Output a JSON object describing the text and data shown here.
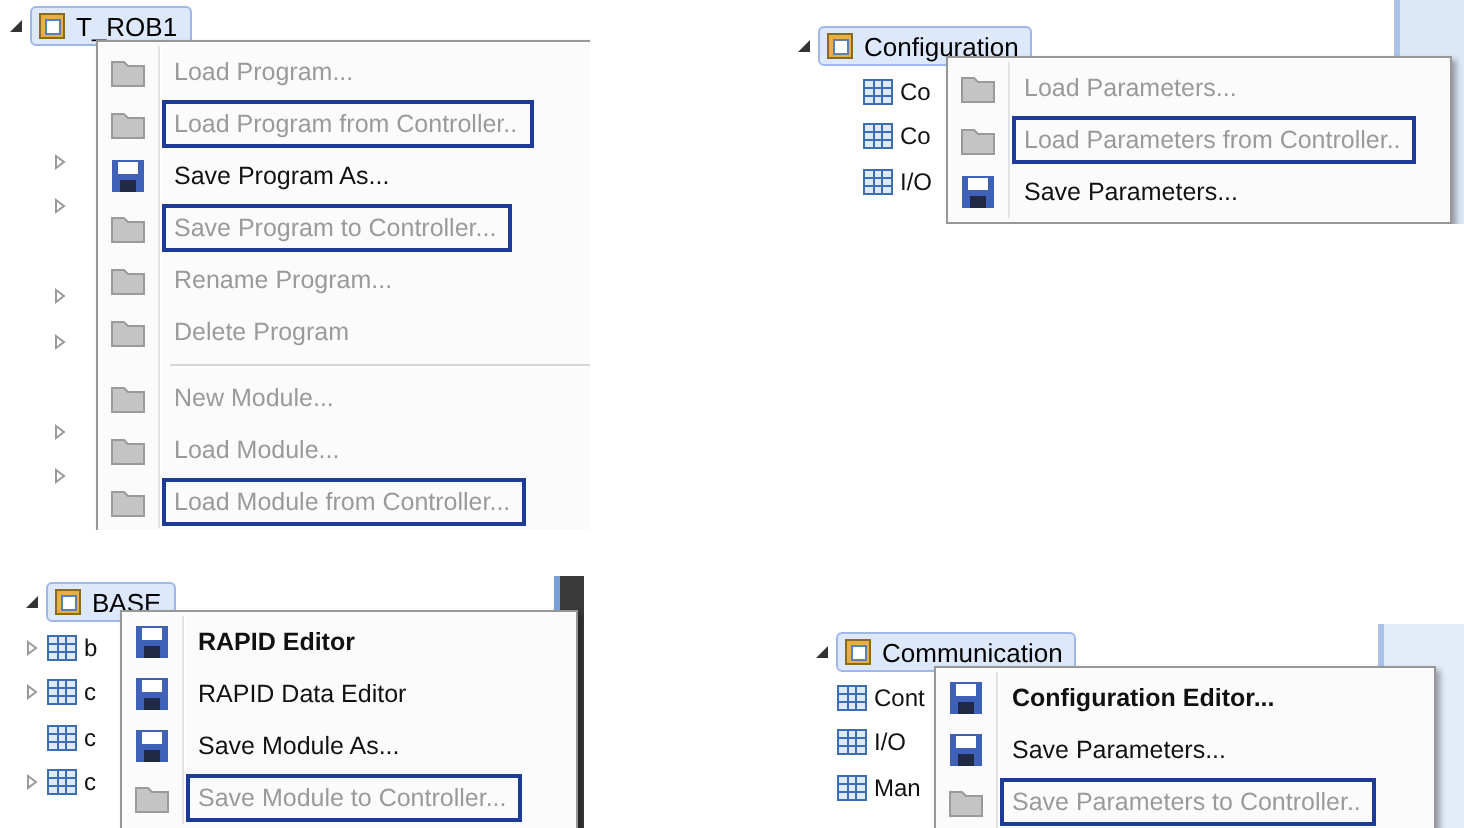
{
  "panels": [
    {
      "node": {
        "label": "T_ROB1",
        "selected": true
      },
      "tree_rows": [
        {
          "expandable": false
        },
        {
          "expandable": false
        },
        {
          "expandable": true
        },
        {
          "expandable": true
        },
        {
          "expandable": false
        },
        {
          "expandable": true
        },
        {
          "expandable": true
        },
        {
          "expandable": false
        },
        {
          "expandable": true
        },
        {
          "expandable": true
        }
      ],
      "menu": [
        {
          "kind": "item",
          "label": "Load Program...",
          "disabled": true,
          "outlined": false,
          "default": false
        },
        {
          "kind": "item",
          "label": "Load Program from Controller..",
          "disabled": true,
          "outlined": true,
          "default": false
        },
        {
          "kind": "item",
          "label": "Save Program As...",
          "disabled": false,
          "outlined": false,
          "default": false
        },
        {
          "kind": "item",
          "label": "Save Program to Controller...",
          "disabled": true,
          "outlined": true,
          "default": false
        },
        {
          "kind": "item",
          "label": "Rename Program...",
          "disabled": true,
          "outlined": false,
          "default": false
        },
        {
          "kind": "item",
          "label": "Delete Program",
          "disabled": true,
          "outlined": false,
          "default": false
        },
        {
          "kind": "separator"
        },
        {
          "kind": "item",
          "label": "New Module...",
          "disabled": true,
          "outlined": false,
          "default": false
        },
        {
          "kind": "item",
          "label": "Load Module...",
          "disabled": true,
          "outlined": false,
          "default": false
        },
        {
          "kind": "item",
          "label": "Load Module from Controller...",
          "disabled": true,
          "outlined": true,
          "default": false
        }
      ]
    },
    {
      "node": {
        "label": "Configuration",
        "selected": true
      },
      "tree_rows": [
        {
          "label": "Co",
          "expandable": false
        },
        {
          "label": "Co",
          "expandable": false
        },
        {
          "label": "I/O",
          "expandable": false
        }
      ],
      "menu": [
        {
          "kind": "item",
          "label": "Load Parameters...",
          "disabled": true,
          "outlined": false,
          "default": false
        },
        {
          "kind": "item",
          "label": "Load Parameters from Controller..",
          "disabled": true,
          "outlined": true,
          "default": false
        },
        {
          "kind": "item",
          "label": "Save Parameters...",
          "disabled": false,
          "outlined": false,
          "default": false
        }
      ]
    },
    {
      "node": {
        "label": "BASE",
        "selected": true
      },
      "tree_rows": [
        {
          "label": "b",
          "expandable": true
        },
        {
          "label": "c",
          "expandable": true
        },
        {
          "label": "c",
          "expandable": false
        },
        {
          "label": "c",
          "expandable": true
        }
      ],
      "menu": [
        {
          "kind": "item",
          "label": "RAPID Editor",
          "disabled": false,
          "outlined": false,
          "default": true
        },
        {
          "kind": "item",
          "label": "RAPID Data Editor",
          "disabled": false,
          "outlined": false,
          "default": false
        },
        {
          "kind": "item",
          "label": "Save Module As...",
          "disabled": false,
          "outlined": false,
          "default": false
        },
        {
          "kind": "item",
          "label": "Save Module to Controller...",
          "disabled": true,
          "outlined": true,
          "default": false
        }
      ]
    },
    {
      "node": {
        "label": "Communication",
        "selected": true
      },
      "tree_rows": [
        {
          "label": "Cont",
          "expandable": false
        },
        {
          "label": "I/O",
          "expandable": false
        },
        {
          "label": "Man",
          "expandable": false
        }
      ],
      "menu": [
        {
          "kind": "item",
          "label": "Configuration Editor...",
          "disabled": false,
          "outlined": false,
          "default": true
        },
        {
          "kind": "item",
          "label": "Save Parameters...",
          "disabled": false,
          "outlined": false,
          "default": false
        },
        {
          "kind": "item",
          "label": "Save Parameters to Controller..",
          "disabled": true,
          "outlined": true,
          "default": false
        }
      ]
    }
  ]
}
